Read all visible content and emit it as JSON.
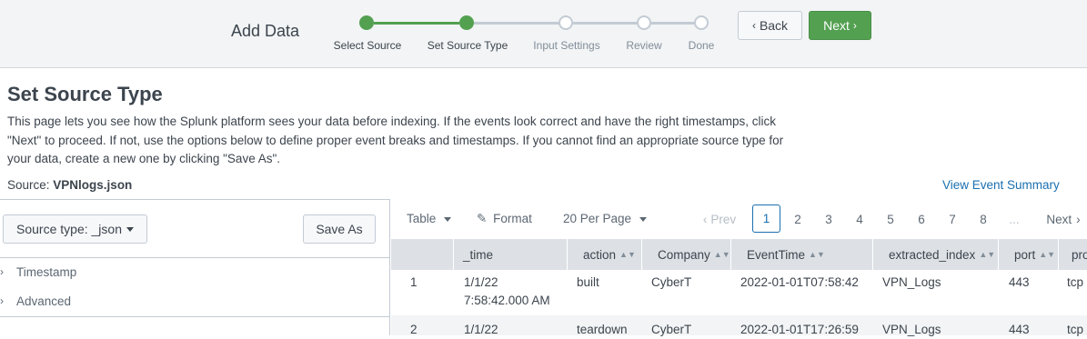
{
  "header": {
    "title": "Add Data",
    "back_label": "Back",
    "next_label": "Next",
    "steps": [
      {
        "label": "Select Source",
        "state": "done"
      },
      {
        "label": "Set Source Type",
        "state": "done"
      },
      {
        "label": "Input Settings",
        "state": "todo"
      },
      {
        "label": "Review",
        "state": "todo"
      },
      {
        "label": "Done",
        "state": "todo"
      }
    ],
    "colors": {
      "done": "#53a051",
      "todo": "#c3cbd4"
    }
  },
  "page": {
    "title": "Set Source Type",
    "description_lines": [
      "This page lets you see how the Splunk platform sees your data before indexing. If the events look correct and have the right timestamps, click",
      "\"Next\" to proceed. If not, use the options below to define proper event breaks and timestamps. If you cannot find an appropriate source type for",
      "your data, create a new one by clicking \"Save As\"."
    ],
    "source_label": "Source:",
    "source_value": "VPNlogs.json",
    "view_summary_link": "View Event Summary"
  },
  "left_panel": {
    "source_type_label": "Source type: _json",
    "save_as_label": "Save As",
    "sections": [
      "Timestamp",
      "Advanced"
    ]
  },
  "toolbar": {
    "table_label": "Table",
    "format_label": "Format",
    "per_page_label": "20 Per Page",
    "prev_label": "Prev",
    "next_label": "Next",
    "pages": [
      "1",
      "2",
      "3",
      "4",
      "5",
      "6",
      "7",
      "8"
    ],
    "current_page": "1",
    "ellipsis": "..."
  },
  "table": {
    "columns": [
      "_time",
      "action",
      "Company",
      "EventTime",
      "extracted_index",
      "port",
      "pro"
    ],
    "rows": [
      {
        "num": "1",
        "time_date": "1/1/22",
        "time_clock": "7:58:42.000 AM",
        "action": "built",
        "company": "CyberT",
        "event_time": "2022-01-01T07:58:42",
        "index": "VPN_Logs",
        "port": "443",
        "proto": "tcp"
      },
      {
        "num": "2",
        "time_date": "1/1/22",
        "time_clock": "",
        "action": "teardown",
        "company": "CyberT",
        "event_time": "2022-01-01T17:26:59",
        "index": "VPN_Logs",
        "port": "443",
        "proto": "tcp"
      }
    ],
    "header_color": "#dde1e5",
    "alt_row_color": "#f2f4f5"
  }
}
